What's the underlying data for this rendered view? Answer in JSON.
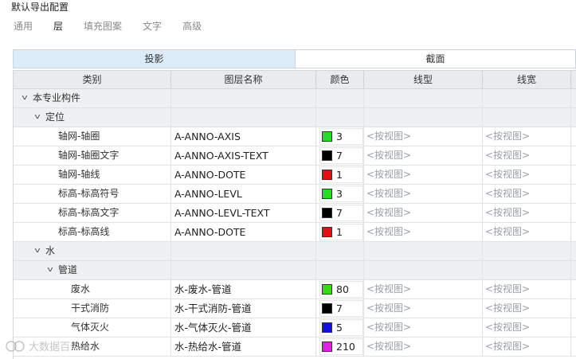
{
  "title": "默认导出配置",
  "tabs": [
    {
      "label": "通用"
    },
    {
      "label": "层"
    },
    {
      "label": "填充图案"
    },
    {
      "label": "文字"
    },
    {
      "label": "高级"
    }
  ],
  "active_tab": "层",
  "segment": {
    "left": "投影",
    "right": "截面",
    "selected": "投影"
  },
  "columns": [
    "类别",
    "图层名称",
    "颜色",
    "线型",
    "线宽"
  ],
  "placeholder": "<按视图>",
  "rows": [
    {
      "type": "group",
      "level": 0,
      "label": "本专业构件"
    },
    {
      "type": "group",
      "level": 1,
      "label": "定位"
    },
    {
      "type": "item",
      "level": 1,
      "label": "轴网-轴圈",
      "layer": "A-ANNO-AXIS",
      "color": "3",
      "swatch": "#22dd22"
    },
    {
      "type": "item",
      "level": 1,
      "label": "轴网-轴圈文字",
      "layer": "A-ANNO-AXIS-TEXT",
      "color": "7",
      "swatch": "#000000"
    },
    {
      "type": "item",
      "level": 1,
      "label": "轴网-轴线",
      "layer": "A-ANNO-DOTE",
      "color": "1",
      "swatch": "#e01010"
    },
    {
      "type": "item",
      "level": 1,
      "label": "标高-标高符号",
      "layer": "A-ANNO-LEVL",
      "color": "3",
      "swatch": "#22dd22"
    },
    {
      "type": "item",
      "level": 1,
      "label": "标高-标高文字",
      "layer": "A-ANNO-LEVL-TEXT",
      "color": "7",
      "swatch": "#000000"
    },
    {
      "type": "item",
      "level": 1,
      "label": "标高-标高线",
      "layer": "A-ANNO-DOTE",
      "color": "1",
      "swatch": "#e01010"
    },
    {
      "type": "group",
      "level": 1,
      "label": "水"
    },
    {
      "type": "group",
      "level": 2,
      "label": "管道"
    },
    {
      "type": "item",
      "level": 2,
      "label": "废水",
      "layer": "水-废水-管道",
      "color": "80",
      "swatch": "#33dd11"
    },
    {
      "type": "item",
      "level": 2,
      "label": "干式消防",
      "layer": "水-干式消防-管道",
      "color": "7",
      "swatch": "#000000"
    },
    {
      "type": "item",
      "level": 2,
      "label": "气体灭火",
      "layer": "水-气体灭火-管道",
      "color": "5",
      "swatch": "#1010e0"
    },
    {
      "type": "item",
      "level": 2,
      "label": "热给水",
      "layer": "水-热给水-管道",
      "color": "210",
      "swatch": "#e020e0"
    }
  ],
  "watermark": "大数据百"
}
